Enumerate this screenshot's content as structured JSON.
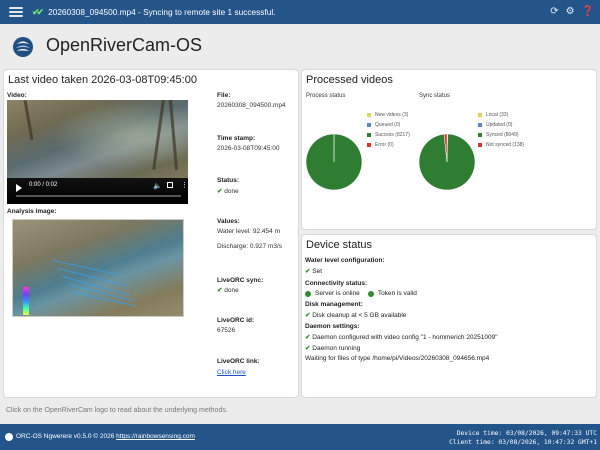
{
  "topbar": {
    "menu_icon": "hamburger-icon",
    "status_icon": "double-check-icon",
    "status_text": "20260308_094500.mp4 - Syncing to remote site 1 successful.",
    "icons": [
      "refresh-icon",
      "gear-icon",
      "help-icon"
    ]
  },
  "header": {
    "title": "OpenRiverCam-OS",
    "logo_icon": "openrivercam-logo"
  },
  "last_video": {
    "title": "Last video taken 2026-03-08T09:45:00",
    "video_label": "Video:",
    "video_time": "0:00 / 0:02",
    "analysis_label": "Analysis image:",
    "file_label": "File:",
    "file_value": "20260308_094500.mp4",
    "timestamp_label": "Time stamp:",
    "timestamp_value": "2026-03-08T09:45:00",
    "status_label": "Status:",
    "status_value": "done",
    "values_label": "Values:",
    "water_level": "Water level: 92.454 m",
    "discharge": "Discharge: 0.927 m3/s",
    "liveorc_sync_label": "LiveORC sync:",
    "liveorc_sync_value": "done",
    "liveorc_id_label": "LiveORC id:",
    "liveorc_id_value": "67526",
    "liveorc_link_label": "LiveORC link:",
    "liveorc_link_text": "Click here"
  },
  "processed": {
    "title": "Processed videos",
    "process_status_label": "Process status",
    "sync_status_label": "Sync status",
    "process_legend": [
      {
        "label": "New videos (3)",
        "color": "#e0d25a"
      },
      {
        "label": "Queued (0)",
        "color": "#5b86c4"
      },
      {
        "label": "Success (8217)",
        "color": "#2e7d32"
      },
      {
        "label": "Error (0)",
        "color": "#d9332b"
      }
    ],
    "sync_legend": [
      {
        "label": "Local (33)",
        "color": "#e0d25a"
      },
      {
        "label": "Updated (0)",
        "color": "#5b86c4"
      },
      {
        "label": "Synced (8049)",
        "color": "#2e7d32"
      },
      {
        "label": "Not synced (138)",
        "color": "#d9332b"
      }
    ]
  },
  "chart_data": [
    {
      "type": "pie",
      "title": "Process status",
      "categories": [
        "New videos",
        "Queued",
        "Success",
        "Error"
      ],
      "values": [
        3,
        0,
        8217,
        0
      ],
      "colors": [
        "#e0d25a",
        "#5b86c4",
        "#2e7d32",
        "#d9332b"
      ]
    },
    {
      "type": "pie",
      "title": "Sync status",
      "categories": [
        "Local",
        "Updated",
        "Synced",
        "Not synced"
      ],
      "values": [
        33,
        0,
        8049,
        138
      ],
      "colors": [
        "#e0d25a",
        "#5b86c4",
        "#2e7d32",
        "#d9332b"
      ]
    }
  ],
  "device": {
    "title": "Device status",
    "water_level_cfg_label": "Water level configuration:",
    "water_level_cfg_value": "Set",
    "connectivity_label": "Connectivity status:",
    "server_online": "Server is online",
    "token_valid": "Token is valid",
    "disk_label": "Disk management:",
    "disk_value": "Disk cleanup at < 5 GB available",
    "daemon_label": "Daemon settings:",
    "daemon_config": "Daemon configured with video config \"1 - hommerich 20251009\"",
    "daemon_running": "Daemon running",
    "waiting": "Waiting for files of type /home/pi/Videos/20260308_094656.mp4"
  },
  "hint": "Click on the OpenRiverCam logo to read about the underlying methods.",
  "footer": {
    "left_text": "ORC-OS Ngwerere v0.5.0 © 2026",
    "link_text": "https://rainbowsensing.com",
    "device_time": "Device time: 03/08/2026, 09:47:33 UTC",
    "client_time": "Client time: 03/08/2026, 10:47:32 GMT+1"
  }
}
